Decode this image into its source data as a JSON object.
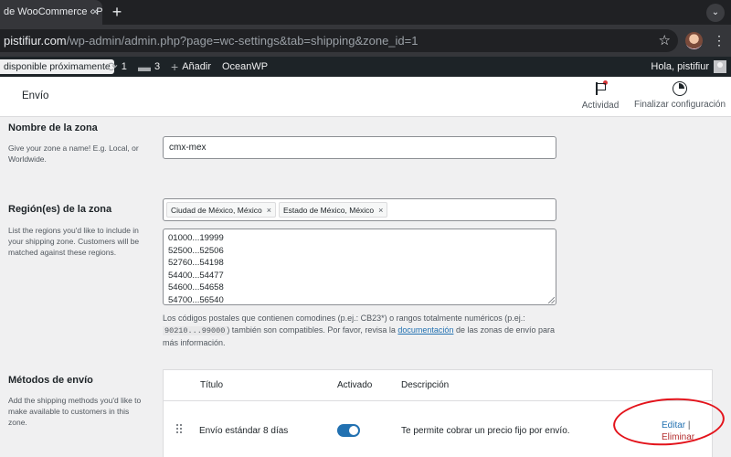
{
  "browser": {
    "tab_title": "de WooCommerce ‹ P",
    "tab_close": "×",
    "new_tab": "+",
    "url_host": "pistifiur.com",
    "url_path": "/wp-admin/admin.php?page=wc-settings&tab=shipping&zone_id=1"
  },
  "adminbar": {
    "notice": "disponible próximamente",
    "updates_count": "1",
    "comments_count": "3",
    "add_new": "Añadir",
    "theme": "OceanWP",
    "greeting": "Hola, pistifiur"
  },
  "header": {
    "title": "Envío",
    "activity": "Actividad",
    "finish_setup": "Finalizar configuración"
  },
  "zone_name": {
    "label": "Nombre de la zona",
    "help": "Give your zone a name! E.g. Local, or Worldwide.",
    "value": "cmx-mex"
  },
  "zone_regions": {
    "label": "Región(es) de la zona",
    "help": "List the regions you'd like to include in your shipping zone. Customers will be matched against these regions.",
    "chips": [
      "Ciudad de México, México",
      "Estado de México, México"
    ],
    "chip_remove": "×",
    "postcodes": [
      "01000...19999",
      "52500...52506",
      "52760...54198",
      "54400...54477",
      "54600...54658",
      "54700...56540"
    ],
    "note_pre": "Los códigos postales que contienen comodines (p.ej.: CB23*) o rangos totalmente numéricos (p.ej.: ",
    "note_code": "90210...99000",
    "note_mid": ") también son compatibles. Por favor, revisa la ",
    "note_link": "documentación",
    "note_post": " de las zonas de envío para más información."
  },
  "methods": {
    "label": "Métodos de envío",
    "help": "Add the shipping methods you'd like to make available to customers in this zone.",
    "columns": {
      "title": "Título",
      "enabled": "Activado",
      "description": "Descripción"
    },
    "rows": [
      {
        "title": "Envío estándar 8 días",
        "enabled": true,
        "description": "Te permite cobrar un precio fijo por envío.",
        "edit": "Editar",
        "separator": "|",
        "delete": "Eliminar"
      }
    ]
  },
  "colors": {
    "accent": "#2271b1",
    "annotation": "#e3131b",
    "admin_bar": "#1d2327"
  }
}
